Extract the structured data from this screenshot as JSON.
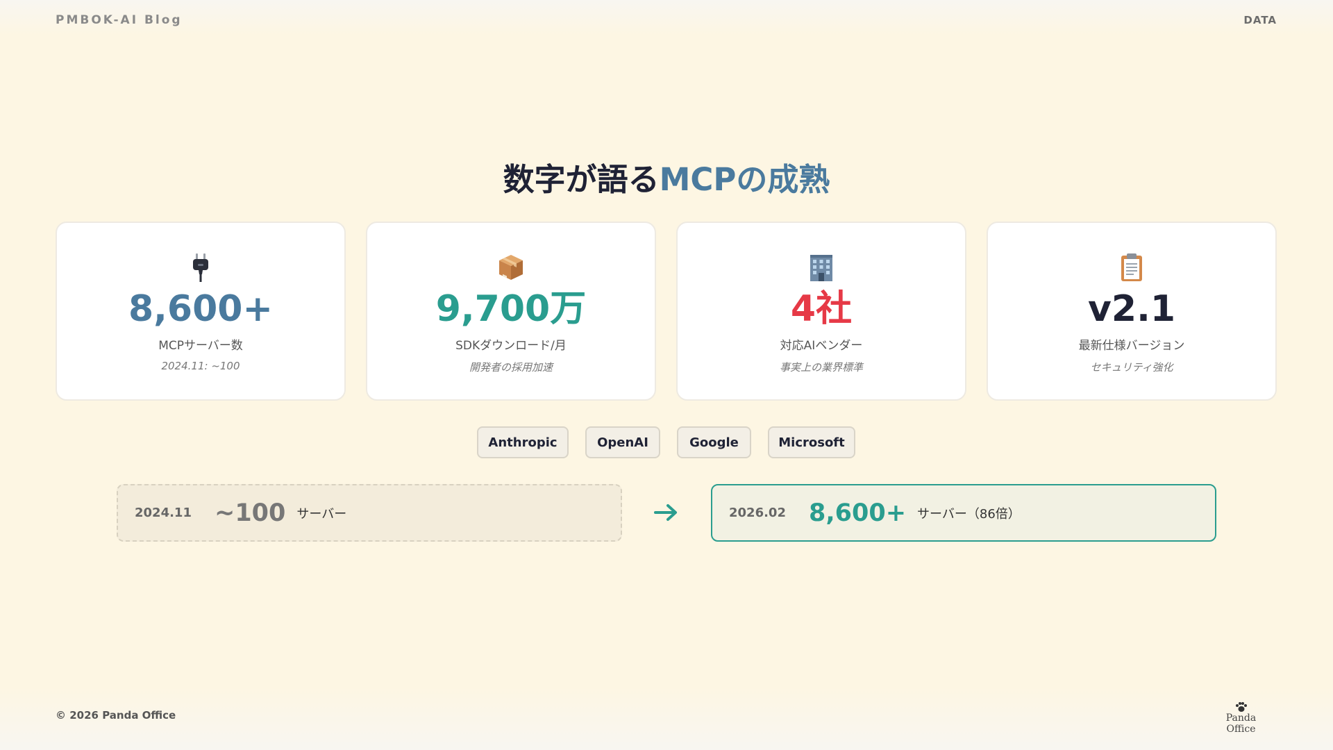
{
  "header": {
    "blog_name": "PMBOK-AI Blog",
    "section_tag": "DATA"
  },
  "title": {
    "main": "数字が語る",
    "highlight": "MCPの成熟"
  },
  "stats": [
    {
      "icon": "plug-icon",
      "value": "8,600+",
      "label": "MCPサーバー数",
      "sub": "2024.11: ~100",
      "color": "#4a7a9e"
    },
    {
      "icon": "package-icon",
      "value": "9,700万",
      "label": "SDKダウンロード/月",
      "sub": "開発者の採用加速",
      "color": "#2a9d8f"
    },
    {
      "icon": "office-building-icon",
      "value": "4社",
      "label": "対応AIベンダー",
      "sub": "事実上の業界標準",
      "color": "#e63946"
    },
    {
      "icon": "clipboard-icon",
      "value": "v2.1",
      "label": "最新仕様バージョン",
      "sub": "セキュリティ強化",
      "color": "#1f2235"
    }
  ],
  "vendors": [
    "Anthropic",
    "OpenAI",
    "Google",
    "Microsoft"
  ],
  "comparison": {
    "before": {
      "date": "2024.11",
      "value": "~100",
      "unit": "サーバー"
    },
    "after": {
      "date": "2026.02",
      "value": "8,600+",
      "unit": "サーバー（86倍）"
    },
    "accent": "#2a9d8f"
  },
  "footer": {
    "copyright": "© 2026 Panda Office",
    "logo_text": "Panda Office",
    "logo_icon": "paw-icon"
  }
}
